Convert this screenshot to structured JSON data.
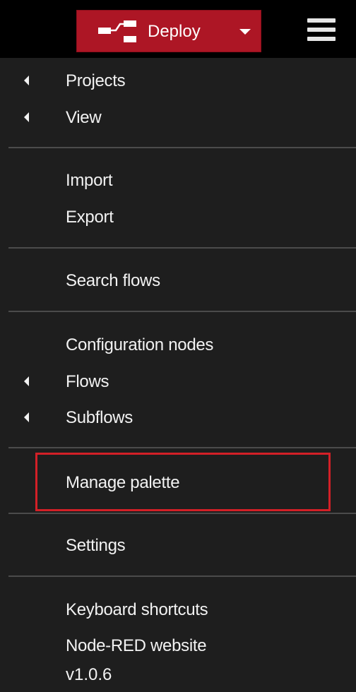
{
  "header": {
    "deploy_label": "Deploy",
    "deploy_icon": "deploy-flow-icon",
    "deploy_color": "#ad1625",
    "menu_icon": "hamburger-menu-icon"
  },
  "menu": {
    "projects": "Projects",
    "view": "View",
    "import": "Import",
    "export": "Export",
    "search_flows": "Search flows",
    "configuration_nodes": "Configuration nodes",
    "flows": "Flows",
    "subflows": "Subflows",
    "manage_palette": "Manage palette",
    "settings": "Settings",
    "keyboard_shortcuts": "Keyboard shortcuts",
    "node_red_website": "Node-RED website",
    "version": "v1.0.6"
  },
  "highlight_color": "#d32027"
}
